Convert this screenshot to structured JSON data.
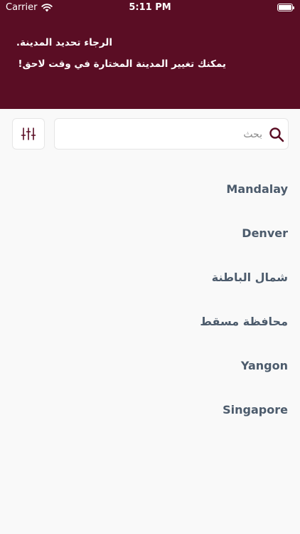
{
  "status_bar": {
    "carrier": "Carrier",
    "time": "5:11 PM"
  },
  "header": {
    "line1": "الرجاء تحديد المدينة.",
    "line2": "يمكنك تغيير المدينة المختارة في وقت لاحق!"
  },
  "search": {
    "placeholder": "بحث",
    "value": ""
  },
  "icons": {
    "filter": "sliders-icon",
    "search": "search-icon",
    "wifi": "wifi-icon",
    "battery": "battery-icon"
  },
  "colors": {
    "header_bg": "#5a0d24",
    "search_icon": "#5a0d24",
    "city_text": "#4c5b6c",
    "page_bg": "#f9f9f9"
  },
  "cities": [
    {
      "name": "Mandalay"
    },
    {
      "name": "Denver"
    },
    {
      "name": "شمال الباطنة"
    },
    {
      "name": "محافظة مسقط"
    },
    {
      "name": "Yangon"
    },
    {
      "name": "Singapore"
    }
  ]
}
